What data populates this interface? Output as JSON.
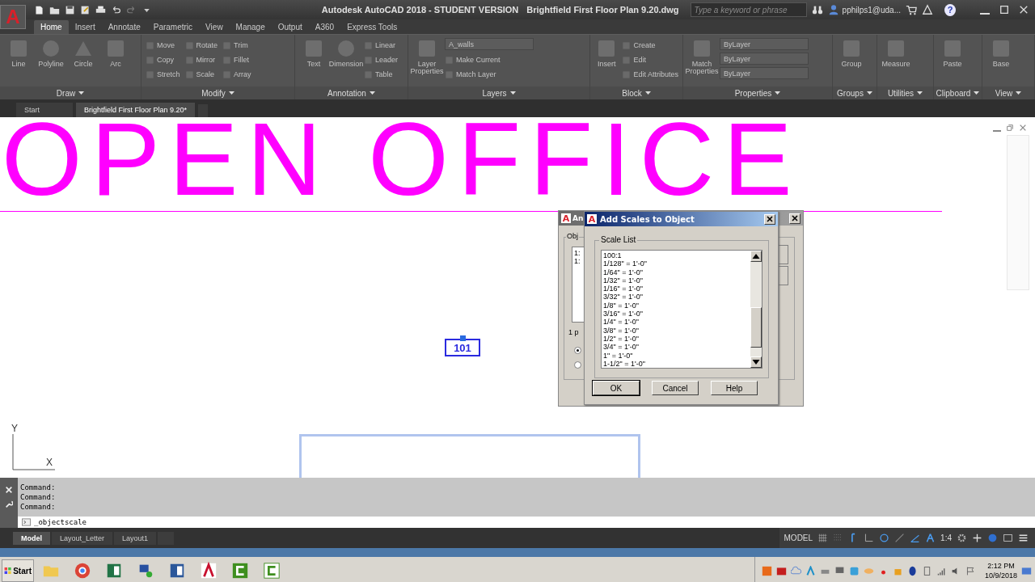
{
  "window": {
    "title": "Autodesk AutoCAD 2018 - STUDENT VERSION",
    "document": "Brightfield First Floor Plan 9.20.dwg"
  },
  "app_button": {
    "label": "A"
  },
  "search": {
    "placeholder": "Type a keyword or phrase"
  },
  "user": {
    "name": "pphilps1@uda..."
  },
  "help": {
    "label": "?"
  },
  "ribbon": {
    "tabs": [
      {
        "label": "Home",
        "selected": true
      },
      {
        "label": "Insert",
        "selected": false
      },
      {
        "label": "Annotate",
        "selected": false
      },
      {
        "label": "Parametric",
        "selected": false
      },
      {
        "label": "View",
        "selected": false
      },
      {
        "label": "Manage",
        "selected": false
      },
      {
        "label": "Output",
        "selected": false
      },
      {
        "label": "A360",
        "selected": false
      },
      {
        "label": "Express Tools",
        "selected": false
      }
    ],
    "panels": [
      {
        "title": "Draw",
        "tools": [
          {
            "label": "Line",
            "kind": "large"
          },
          {
            "label": "Polyline",
            "kind": "large"
          },
          {
            "label": "Circle",
            "kind": "large"
          },
          {
            "label": "Arc",
            "kind": "large"
          }
        ]
      },
      {
        "title": "Modify",
        "tools": [
          {
            "label": "Move",
            "kind": "small"
          },
          {
            "label": "Copy",
            "kind": "small"
          },
          {
            "label": "Stretch",
            "kind": "small"
          },
          {
            "label": "Rotate",
            "kind": "small"
          },
          {
            "label": "Mirror",
            "kind": "small"
          },
          {
            "label": "Scale",
            "kind": "small"
          },
          {
            "label": "Trim",
            "kind": "small"
          },
          {
            "label": "Fillet",
            "kind": "small"
          },
          {
            "label": "Array",
            "kind": "small"
          }
        ]
      },
      {
        "title": "Annotation",
        "tools": [
          {
            "label": "Text",
            "kind": "large"
          },
          {
            "label": "Dimension",
            "kind": "large"
          },
          {
            "label": "Linear",
            "kind": "small"
          },
          {
            "label": "Leader",
            "kind": "small"
          },
          {
            "label": "Table",
            "kind": "small"
          }
        ]
      },
      {
        "title": "Layers",
        "tools": [
          {
            "label": "Layer Properties",
            "kind": "large"
          },
          {
            "label": "A_walls",
            "kind": "dropdown"
          },
          {
            "label": "Make Current",
            "kind": "small"
          },
          {
            "label": "Match Layer",
            "kind": "small"
          }
        ]
      },
      {
        "title": "Block",
        "tools": [
          {
            "label": "Insert",
            "kind": "large"
          },
          {
            "label": "Create",
            "kind": "small"
          },
          {
            "label": "Edit",
            "kind": "small"
          },
          {
            "label": "Edit Attributes",
            "kind": "small"
          }
        ]
      },
      {
        "title": "Properties",
        "tools": [
          {
            "label": "Match Properties",
            "kind": "large"
          },
          {
            "label": "ByLayer",
            "kind": "dropdown"
          },
          {
            "label": "ByLayer",
            "kind": "dropdown"
          },
          {
            "label": "ByLayer",
            "kind": "dropdown"
          }
        ]
      },
      {
        "title": "Groups",
        "tools": [
          {
            "label": "Group",
            "kind": "large"
          }
        ]
      },
      {
        "title": "Utilities",
        "tools": [
          {
            "label": "Measure",
            "kind": "large"
          }
        ]
      },
      {
        "title": "Clipboard",
        "tools": [
          {
            "label": "Paste",
            "kind": "large"
          }
        ]
      },
      {
        "title": "View",
        "tools": [
          {
            "label": "Base",
            "kind": "large"
          }
        ]
      }
    ]
  },
  "file_tabs": [
    {
      "label": "Start",
      "selected": false
    },
    {
      "label": "Brightfield First Floor Plan 9.20*",
      "selected": true
    }
  ],
  "drawing": {
    "heading": "OPEN OFFICE",
    "room_tag": "101",
    "ucs": {
      "x_label": "X",
      "y_label": "Y"
    }
  },
  "back_dialog": {
    "icon": "A",
    "title": "An",
    "group": "Obj",
    "list": [
      "1:",
      "1:"
    ],
    "label": "1 p",
    "radios": [
      {
        "selected": true
      },
      {
        "selected": false
      }
    ]
  },
  "dialog": {
    "icon": "A",
    "title": "Add Scales to Object",
    "group": "Scale List",
    "scales": [
      "100:1",
      "1/128\" = 1'-0\"",
      "1/64\" = 1'-0\"",
      "1/32\" = 1'-0\"",
      "1/16\" = 1'-0\"",
      "3/32\" = 1'-0\"",
      "1/8\" = 1'-0\"",
      "3/16\" = 1'-0\"",
      "1/4\" = 1'-0\"",
      "3/8\" = 1'-0\"",
      "1/2\" = 1'-0\"",
      "3/4\" = 1'-0\"",
      "1\" = 1'-0\"",
      "1-1/2\" = 1'-0\""
    ],
    "buttons": [
      "OK",
      "Cancel",
      "Help"
    ]
  },
  "command": {
    "history": [
      "Command:",
      "Command:",
      "Command:"
    ],
    "input": "_objectscale"
  },
  "layout_tabs": [
    {
      "label": "Model",
      "selected": true
    },
    {
      "label": "Layout_Letter",
      "selected": false
    },
    {
      "label": "Layout1",
      "selected": false
    }
  ],
  "status_bar": {
    "mode": "MODEL",
    "scale": "1:4"
  },
  "taskbar": {
    "start": "Start",
    "time": "2:12 PM",
    "date": "10/9/2018"
  }
}
